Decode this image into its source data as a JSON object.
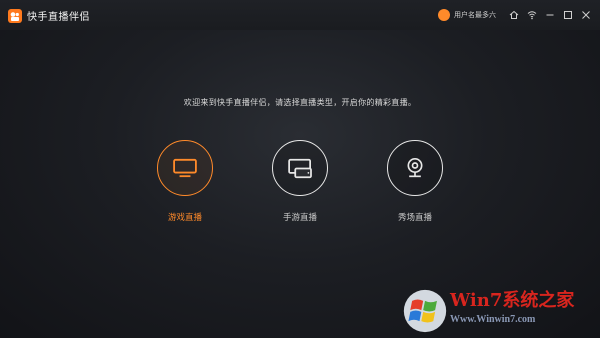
{
  "app": {
    "title": "快手直播伴侣",
    "username": "用户名最多六",
    "accent": "#ff8a2a"
  },
  "titlebar_icons": [
    "home-icon",
    "wifi-icon",
    "minimize-icon",
    "maximize-icon",
    "close-icon"
  ],
  "main": {
    "welcome": "欢迎来到快手直播伴侣，请选择直播类型，开启你的精彩直播。",
    "modes": [
      {
        "label": "游戏直播",
        "icon": "monitor-icon",
        "selected": true
      },
      {
        "label": "手游直播",
        "icon": "mobile-screen-icon",
        "selected": false
      },
      {
        "label": "秀场直播",
        "icon": "webcam-icon",
        "selected": false
      }
    ]
  },
  "watermark": {
    "brand": "Win7系统之家",
    "url": "Www.Winwin7.com"
  }
}
